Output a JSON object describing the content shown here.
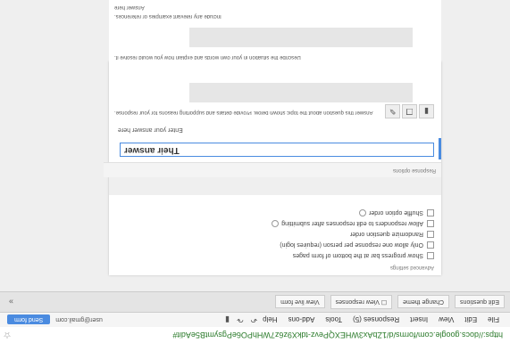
{
  "browser": {
    "url": "https://docs.google.com/forms/d/1ZbAx3WHEXQPevz-tdkX9z6z7WHhPO6ePgsymtB5eAdit#",
    "star_icon": "star-icon"
  },
  "menubar": {
    "items": [
      "File",
      "Edit",
      "View",
      "Insert",
      "Responses (5)",
      "Tools",
      "Add-ons",
      "Help"
    ],
    "account": "user@gmail.com",
    "share_label": "Send form"
  },
  "tabbar": {
    "tabs": [
      "Edit questions",
      "Change theme",
      "View responses",
      "View live form"
    ],
    "expand_icon": "chevron-double-down-icon"
  },
  "form": {
    "options_header": "Advanced settings",
    "options": [
      "Show progress bar at the bottom of form pages",
      "Only allow one response per person (requires login)",
      "Randomize question order",
      "Allow responders to edit responses after submitting",
      "Shuffle option order"
    ],
    "question_header": "Response options",
    "answer_value": "Their answer",
    "caption": "Enter your answer here",
    "description": "Answer this question about the topic shown below. Provide details and supporting reasons for your response.",
    "question2_description": "Describe the situation in your own words and explain how you would resolve it.",
    "question2_desc2": "Include any relevant examples or references.",
    "question2_hint": "Answer here"
  }
}
